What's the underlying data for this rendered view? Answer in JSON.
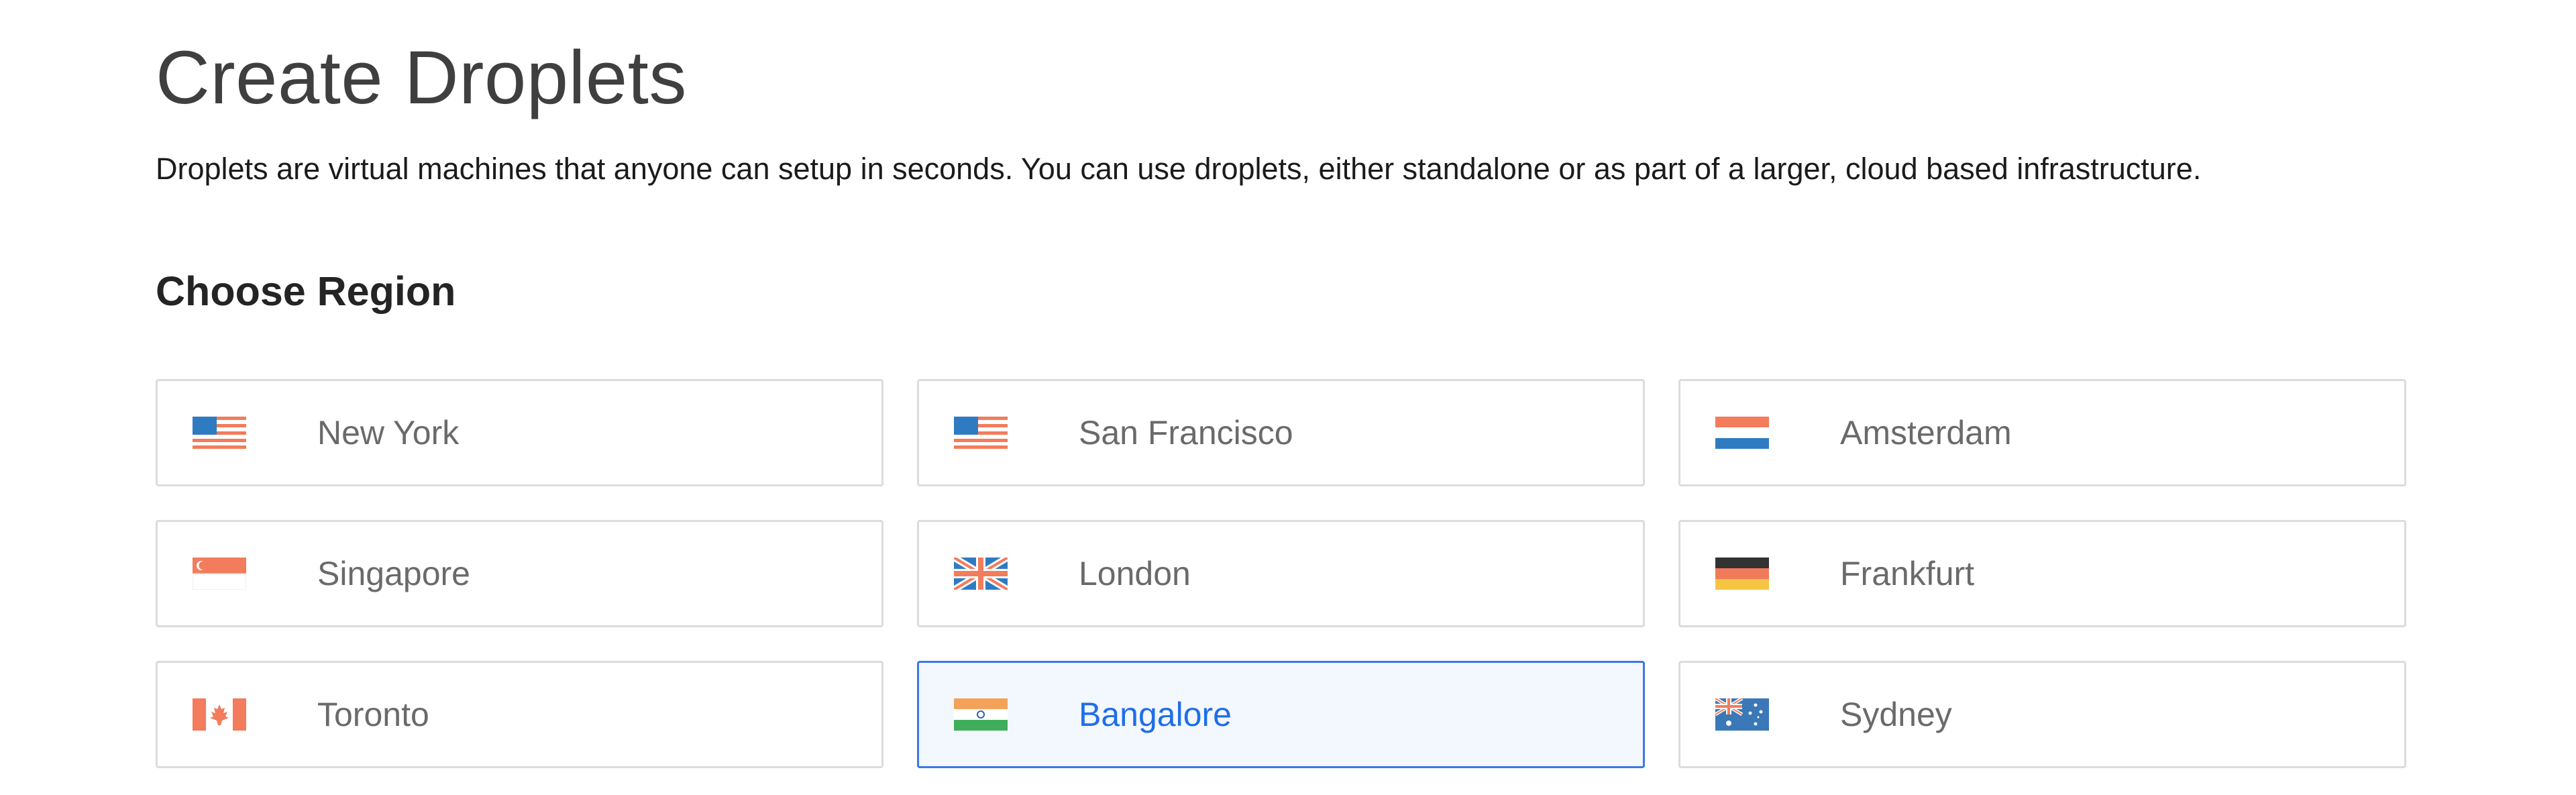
{
  "page": {
    "title": "Create Droplets",
    "description": "Droplets are virtual machines that anyone can setup in seconds. You can use droplets, either standalone or as part of a larger, cloud based infrastructure."
  },
  "region_section": {
    "heading": "Choose Region",
    "selected": "Bangalore",
    "regions": [
      {
        "label": "New York",
        "flag": "us-flag-icon"
      },
      {
        "label": "San Francisco",
        "flag": "us-flag-icon"
      },
      {
        "label": "Amsterdam",
        "flag": "netherlands-flag-icon"
      },
      {
        "label": "Singapore",
        "flag": "singapore-flag-icon"
      },
      {
        "label": "London",
        "flag": "uk-flag-icon"
      },
      {
        "label": "Frankfurt",
        "flag": "germany-flag-icon"
      },
      {
        "label": "Toronto",
        "flag": "canada-flag-icon"
      },
      {
        "label": "Bangalore",
        "flag": "india-flag-icon"
      },
      {
        "label": "Sydney",
        "flag": "australia-flag-icon"
      }
    ]
  },
  "colors": {
    "selected_border": "#3b78e7",
    "selected_background": "#f3f7fe",
    "selected_text": "#1f6ee9",
    "card_border": "#dcdcdc"
  }
}
